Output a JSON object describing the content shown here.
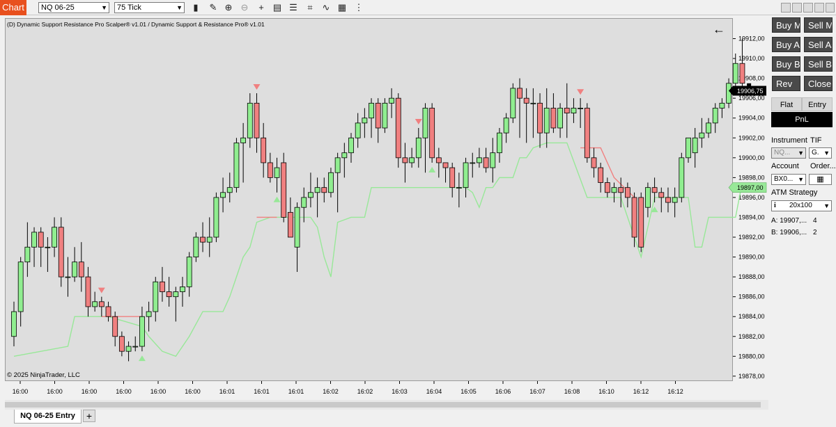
{
  "toolbar": {
    "chart_tab": "Chart",
    "instrument": "NQ 06-25",
    "interval": "75 Tick",
    "icons": [
      "bar-type-icon",
      "drawing-tool-icon",
      "zoom-in-icon",
      "zoom-out-icon",
      "crosshair-icon",
      "data-box-icon",
      "properties-icon",
      "strategies-icon",
      "indicators-icon",
      "templates-icon"
    ]
  },
  "chart": {
    "title": "(D) Dynamic Support Resistance Pro Scalper® v1.01 / Dynamic Support & Resistance Pro® v1.01",
    "copyright": "© 2025 NinjaTrader, LLC",
    "back_arrow": "←",
    "last_price_label": "19906,75",
    "indicator_price_label": "19897,00",
    "y_ticks": [
      "19912,00",
      "19910,00",
      "19908,00",
      "19906,00",
      "19904,00",
      "19902,00",
      "19900,00",
      "19898,00",
      "19896,00",
      "19894,00",
      "19892,00",
      "19890,00",
      "19888,00",
      "19886,00",
      "19884,00",
      "19882,00",
      "19880,00",
      "19878,00"
    ],
    "x_ticks": [
      "16:00",
      "16:00",
      "16:00",
      "16:00",
      "16:00",
      "16:00",
      "16:01",
      "16:01",
      "16:01",
      "16:02",
      "16:02",
      "16:03",
      "16:04",
      "16:05",
      "16:06",
      "16:07",
      "16:08",
      "16:10",
      "16:12",
      "16:12"
    ],
    "colors": {
      "up": "#90ee90",
      "down": "#f08080",
      "support": "#98e898",
      "resistance": "#f08080",
      "background": "#dedede"
    }
  },
  "chart_data": {
    "type": "candlestick",
    "ylim": [
      19877.5,
      19914.0
    ],
    "candles": [
      {
        "o": 19882.0,
        "h": 19885.5,
        "l": 19881.0,
        "c": 19884.5
      },
      {
        "o": 19884.5,
        "h": 19890.0,
        "l": 19883.0,
        "c": 19889.5
      },
      {
        "o": 19889.5,
        "h": 19893.5,
        "l": 19888.0,
        "c": 19891.0
      },
      {
        "o": 19891.0,
        "h": 19893.0,
        "l": 19889.0,
        "c": 19892.5
      },
      {
        "o": 19892.5,
        "h": 19893.0,
        "l": 19889.0,
        "c": 19891.0
      },
      {
        "o": 19891.0,
        "h": 19892.0,
        "l": 19888.5,
        "c": 19891.0
      },
      {
        "o": 19891.0,
        "h": 19894.0,
        "l": 19890.0,
        "c": 19893.0
      },
      {
        "o": 19893.0,
        "h": 19894.0,
        "l": 19887.0,
        "c": 19888.0
      },
      {
        "o": 19888.0,
        "h": 19890.0,
        "l": 19886.0,
        "c": 19888.0
      },
      {
        "o": 19888.0,
        "h": 19891.0,
        "l": 19887.5,
        "c": 19889.5
      },
      {
        "o": 19889.5,
        "h": 19891.5,
        "l": 19886.5,
        "c": 19888.0
      },
      {
        "o": 19888.0,
        "h": 19889.0,
        "l": 19884.0,
        "c": 19885.0
      },
      {
        "o": 19885.0,
        "h": 19886.5,
        "l": 19884.5,
        "c": 19885.5
      },
      {
        "o": 19885.5,
        "h": 19886.0,
        "l": 19884.0,
        "c": 19885.0
      },
      {
        "o": 19885.0,
        "h": 19885.5,
        "l": 19883.5,
        "c": 19884.0
      },
      {
        "o": 19884.0,
        "h": 19884.5,
        "l": 19881.0,
        "c": 19882.0
      },
      {
        "o": 19882.0,
        "h": 19882.5,
        "l": 19880.0,
        "c": 19880.5
      },
      {
        "o": 19880.5,
        "h": 19881.5,
        "l": 19879.5,
        "c": 19881.0
      },
      {
        "o": 19881.0,
        "h": 19882.0,
        "l": 19880.5,
        "c": 19881.0
      },
      {
        "o": 19881.0,
        "h": 19885.0,
        "l": 19880.5,
        "c": 19884.0
      },
      {
        "o": 19884.0,
        "h": 19885.5,
        "l": 19882.5,
        "c": 19884.5
      },
      {
        "o": 19884.5,
        "h": 19888.0,
        "l": 19883.5,
        "c": 19887.5
      },
      {
        "o": 19887.5,
        "h": 19889.0,
        "l": 19885.5,
        "c": 19886.5
      },
      {
        "o": 19886.5,
        "h": 19888.0,
        "l": 19885.0,
        "c": 19886.0
      },
      {
        "o": 19886.0,
        "h": 19887.0,
        "l": 19883.5,
        "c": 19886.5
      },
      {
        "o": 19886.5,
        "h": 19888.0,
        "l": 19885.0,
        "c": 19887.0
      },
      {
        "o": 19887.0,
        "h": 19890.5,
        "l": 19886.0,
        "c": 19890.0
      },
      {
        "o": 19890.0,
        "h": 19892.5,
        "l": 19889.5,
        "c": 19892.0
      },
      {
        "o": 19892.0,
        "h": 19893.5,
        "l": 19890.5,
        "c": 19891.5
      },
      {
        "o": 19891.5,
        "h": 19894.0,
        "l": 19890.0,
        "c": 19892.0
      },
      {
        "o": 19892.0,
        "h": 19896.5,
        "l": 19891.5,
        "c": 19896.0
      },
      {
        "o": 19896.0,
        "h": 19898.0,
        "l": 19894.5,
        "c": 19896.5
      },
      {
        "o": 19896.5,
        "h": 19898.5,
        "l": 19895.5,
        "c": 19897.0
      },
      {
        "o": 19897.0,
        "h": 19902.0,
        "l": 19896.5,
        "c": 19901.5
      },
      {
        "o": 19901.5,
        "h": 19903.5,
        "l": 19897.5,
        "c": 19902.0
      },
      {
        "o": 19902.0,
        "h": 19906.5,
        "l": 19901.0,
        "c": 19905.5
      },
      {
        "o": 19905.5,
        "h": 19906.5,
        "l": 19900.5,
        "c": 19902.0
      },
      {
        "o": 19902.0,
        "h": 19903.5,
        "l": 19898.0,
        "c": 19899.5
      },
      {
        "o": 19899.5,
        "h": 19900.5,
        "l": 19897.5,
        "c": 19898.0
      },
      {
        "o": 19898.0,
        "h": 19900.0,
        "l": 19896.5,
        "c": 19899.0
      },
      {
        "o": 19899.5,
        "h": 19900.5,
        "l": 19893.5,
        "c": 19894.0
      },
      {
        "o": 19894.5,
        "h": 19896.0,
        "l": 19893.0,
        "c": 19892.0
      },
      {
        "o": 19891.0,
        "h": 19895.5,
        "l": 19888.5,
        "c": 19895.0
      },
      {
        "o": 19895.0,
        "h": 19897.0,
        "l": 19893.5,
        "c": 19896.0
      },
      {
        "o": 19896.0,
        "h": 19898.5,
        "l": 19895.0,
        "c": 19896.5
      },
      {
        "o": 19896.5,
        "h": 19898.0,
        "l": 19894.0,
        "c": 19897.0
      },
      {
        "o": 19897.0,
        "h": 19898.0,
        "l": 19895.5,
        "c": 19896.5
      },
      {
        "o": 19896.5,
        "h": 19899.0,
        "l": 19896.0,
        "c": 19898.5
      },
      {
        "o": 19898.5,
        "h": 19900.5,
        "l": 19894.5,
        "c": 19900.0
      },
      {
        "o": 19900.0,
        "h": 19901.5,
        "l": 19898.0,
        "c": 19900.5
      },
      {
        "o": 19900.5,
        "h": 19902.5,
        "l": 19899.5,
        "c": 19902.0
      },
      {
        "o": 19902.0,
        "h": 19904.5,
        "l": 19901.0,
        "c": 19903.5
      },
      {
        "o": 19903.5,
        "h": 19905.0,
        "l": 19902.0,
        "c": 19904.0
      },
      {
        "o": 19904.0,
        "h": 19906.0,
        "l": 19902.0,
        "c": 19905.5
      },
      {
        "o": 19905.5,
        "h": 19906.0,
        "l": 19901.5,
        "c": 19903.0
      },
      {
        "o": 19903.0,
        "h": 19906.0,
        "l": 19902.5,
        "c": 19905.5
      },
      {
        "o": 19905.5,
        "h": 19907.0,
        "l": 19904.0,
        "c": 19906.0
      },
      {
        "o": 19906.0,
        "h": 19906.5,
        "l": 19899.0,
        "c": 19900.0
      },
      {
        "o": 19900.0,
        "h": 19901.5,
        "l": 19897.5,
        "c": 19899.5
      },
      {
        "o": 19899.5,
        "h": 19901.0,
        "l": 19899.0,
        "c": 19900.0
      },
      {
        "o": 19900.0,
        "h": 19903.0,
        "l": 19899.0,
        "c": 19902.0
      },
      {
        "o": 19902.0,
        "h": 19905.5,
        "l": 19898.5,
        "c": 19905.0
      },
      {
        "o": 19905.0,
        "h": 19905.5,
        "l": 19899.5,
        "c": 19900.0
      },
      {
        "o": 19900.0,
        "h": 19901.0,
        "l": 19898.0,
        "c": 19899.5
      },
      {
        "o": 19899.5,
        "h": 19899.5,
        "l": 19897.5,
        "c": 19899.0
      },
      {
        "o": 19899.0,
        "h": 19899.5,
        "l": 19896.0,
        "c": 19897.0
      },
      {
        "o": 19897.0,
        "h": 19898.5,
        "l": 19895.0,
        "c": 19897.0
      },
      {
        "o": 19897.0,
        "h": 19900.0,
        "l": 19896.0,
        "c": 19899.5
      },
      {
        "o": 19899.5,
        "h": 19900.5,
        "l": 19898.0,
        "c": 19899.5
      },
      {
        "o": 19899.5,
        "h": 19901.0,
        "l": 19899.0,
        "c": 19900.0
      },
      {
        "o": 19900.0,
        "h": 19901.0,
        "l": 19898.5,
        "c": 19899.0
      },
      {
        "o": 19899.0,
        "h": 19902.0,
        "l": 19897.5,
        "c": 19900.5
      },
      {
        "o": 19900.5,
        "h": 19903.0,
        "l": 19899.5,
        "c": 19902.5
      },
      {
        "o": 19902.5,
        "h": 19904.5,
        "l": 19901.5,
        "c": 19904.0
      },
      {
        "o": 19904.0,
        "h": 19907.5,
        "l": 19903.5,
        "c": 19907.0
      },
      {
        "o": 19907.0,
        "h": 19908.0,
        "l": 19902.0,
        "c": 19906.0
      },
      {
        "o": 19906.0,
        "h": 19907.0,
        "l": 19901.5,
        "c": 19905.5
      },
      {
        "o": 19905.5,
        "h": 19907.0,
        "l": 19902.0,
        "c": 19905.5
      },
      {
        "o": 19905.5,
        "h": 19906.5,
        "l": 19901.0,
        "c": 19902.5
      },
      {
        "o": 19902.5,
        "h": 19907.0,
        "l": 19901.0,
        "c": 19905.0
      },
      {
        "o": 19905.0,
        "h": 19906.5,
        "l": 19902.5,
        "c": 19903.0
      },
      {
        "o": 19903.0,
        "h": 19905.5,
        "l": 19902.0,
        "c": 19905.0
      },
      {
        "o": 19905.0,
        "h": 19907.5,
        "l": 19902.0,
        "c": 19904.5
      },
      {
        "o": 19904.5,
        "h": 19906.0,
        "l": 19903.5,
        "c": 19905.0
      },
      {
        "o": 19905.0,
        "h": 19906.0,
        "l": 19903.0,
        "c": 19905.0
      },
      {
        "o": 19905.0,
        "h": 19905.5,
        "l": 19899.5,
        "c": 19900.0
      },
      {
        "o": 19900.0,
        "h": 19901.0,
        "l": 19898.0,
        "c": 19899.0
      },
      {
        "o": 19899.0,
        "h": 19899.5,
        "l": 19896.5,
        "c": 19897.5
      },
      {
        "o": 19897.5,
        "h": 19898.0,
        "l": 19896.0,
        "c": 19896.5
      },
      {
        "o": 19896.5,
        "h": 19897.5,
        "l": 19895.5,
        "c": 19897.0
      },
      {
        "o": 19897.0,
        "h": 19898.0,
        "l": 19895.0,
        "c": 19896.5
      },
      {
        "o": 19897.0,
        "h": 19897.5,
        "l": 19895.0,
        "c": 19896.0
      },
      {
        "o": 19896.0,
        "h": 19896.5,
        "l": 19891.0,
        "c": 19892.0
      },
      {
        "o": 19896.0,
        "h": 19896.5,
        "l": 19890.5,
        "c": 19891.0
      },
      {
        "o": 19895.0,
        "h": 19897.5,
        "l": 19894.0,
        "c": 19897.0
      },
      {
        "o": 19897.0,
        "h": 19898.0,
        "l": 19895.5,
        "c": 19896.5
      },
      {
        "o": 19896.5,
        "h": 19897.0,
        "l": 19894.5,
        "c": 19896.0
      },
      {
        "o": 19896.0,
        "h": 19897.0,
        "l": 19894.5,
        "c": 19895.5
      },
      {
        "o": 19895.5,
        "h": 19897.0,
        "l": 19894.0,
        "c": 19896.0
      },
      {
        "o": 19896.0,
        "h": 19900.5,
        "l": 19895.5,
        "c": 19900.0
      },
      {
        "o": 19900.0,
        "h": 19902.0,
        "l": 19899.5,
        "c": 19902.0
      },
      {
        "o": 19900.5,
        "h": 19903.0,
        "l": 19899.0,
        "c": 19902.0
      },
      {
        "o": 19902.0,
        "h": 19904.0,
        "l": 19901.0,
        "c": 19902.5
      },
      {
        "o": 19902.5,
        "h": 19904.0,
        "l": 19902.0,
        "c": 19903.5
      },
      {
        "o": 19903.5,
        "h": 19905.5,
        "l": 19902.5,
        "c": 19905.0
      },
      {
        "o": 19905.0,
        "h": 19906.0,
        "l": 19904.0,
        "c": 19905.5
      },
      {
        "o": 19905.5,
        "h": 19908.0,
        "l": 19905.0,
        "c": 19907.5
      },
      {
        "o": 19907.5,
        "h": 19910.5,
        "l": 19907.0,
        "c": 19909.5
      },
      {
        "o": 19909.5,
        "h": 19912.0,
        "l": 19906.5,
        "c": 19907.5
      }
    ],
    "sell_signal_bars": [
      13,
      36,
      60,
      84
    ],
    "buy_signal_bars": [
      19,
      39,
      62,
      95
    ],
    "support_line": [
      [
        0,
        19880
      ],
      [
        8,
        19881
      ],
      [
        9,
        19884
      ],
      [
        14,
        19884
      ],
      [
        19,
        19883
      ],
      [
        20,
        19882
      ],
      [
        22,
        19880.5
      ],
      [
        24,
        19880
      ],
      [
        26,
        19882
      ],
      [
        28,
        19884.5
      ],
      [
        31,
        19884.5
      ],
      [
        32,
        19886
      ],
      [
        33,
        19888
      ],
      [
        34,
        19890
      ],
      [
        35,
        19891
      ],
      [
        36,
        19893.5
      ],
      [
        38,
        19894
      ],
      [
        44,
        19894
      ],
      [
        45,
        19893
      ],
      [
        46,
        19890
      ],
      [
        47,
        19888
      ],
      [
        48,
        19893.5
      ],
      [
        50,
        19894
      ],
      [
        52,
        19894
      ],
      [
        53,
        19897
      ],
      [
        60,
        19897
      ],
      [
        65,
        19897
      ],
      [
        67,
        19897
      ],
      [
        68,
        19896.5
      ],
      [
        69,
        19895
      ],
      [
        70,
        19897
      ],
      [
        71,
        19897
      ],
      [
        72,
        19898
      ],
      [
        74,
        19898
      ],
      [
        75,
        19900
      ],
      [
        76,
        19900
      ],
      [
        77,
        19901
      ],
      [
        79,
        19901.5
      ],
      [
        82,
        19901.5
      ],
      [
        85,
        19896
      ],
      [
        90,
        19896
      ],
      [
        92,
        19892
      ],
      [
        93,
        19890
      ],
      [
        95,
        19896
      ],
      [
        98,
        19896
      ],
      [
        100,
        19896
      ],
      [
        101,
        19891
      ],
      [
        102,
        19891
      ],
      [
        103,
        19894
      ],
      [
        107,
        19894
      ],
      [
        108,
        19897.5
      ]
    ],
    "resistance_lines": [
      [
        [
          13,
          19884
        ],
        [
          19,
          19884
        ]
      ],
      [
        [
          36,
          19894
        ],
        [
          39,
          19894
        ]
      ],
      [
        [
          84,
          19901
        ],
        [
          87,
          19901
        ],
        [
          89,
          19898
        ],
        [
          92,
          19896
        ]
      ]
    ]
  },
  "side_panel": {
    "buttons": [
      {
        "label": "Buy M",
        "name": "buy-market-button"
      },
      {
        "label": "Sell M",
        "name": "sell-market-button"
      },
      {
        "label": "Buy Ask",
        "name": "buy-ask-button"
      },
      {
        "label": "Sell Ask",
        "name": "sell-ask-button"
      },
      {
        "label": "Buy Bid",
        "name": "buy-bid-button"
      },
      {
        "label": "Sell Bid",
        "name": "sell-bid-button"
      },
      {
        "label": "Rev",
        "name": "reverse-button"
      },
      {
        "label": "Close",
        "name": "close-button"
      }
    ],
    "flat_tab": "Flat",
    "entry_tab": "Entry",
    "pnl": "PnL",
    "instrument_label": "Instrument",
    "tif_label": "TIF",
    "instrument_value": "NQ...",
    "tif_value": "G.",
    "account_label": "Account",
    "order_label": "Order...",
    "account_value": "BX0...",
    "atm_label": "ATM Strategy",
    "atm_value": "20x100",
    "atm_info_icon": "info-icon",
    "a_label": "A:",
    "a_value": "19907,...",
    "a_count": "4",
    "b_label": "B:",
    "b_value": "19906,...",
    "b_count": "2"
  },
  "bottom": {
    "tab_label": "NQ 06-25 Entry",
    "add_tab": "+"
  }
}
